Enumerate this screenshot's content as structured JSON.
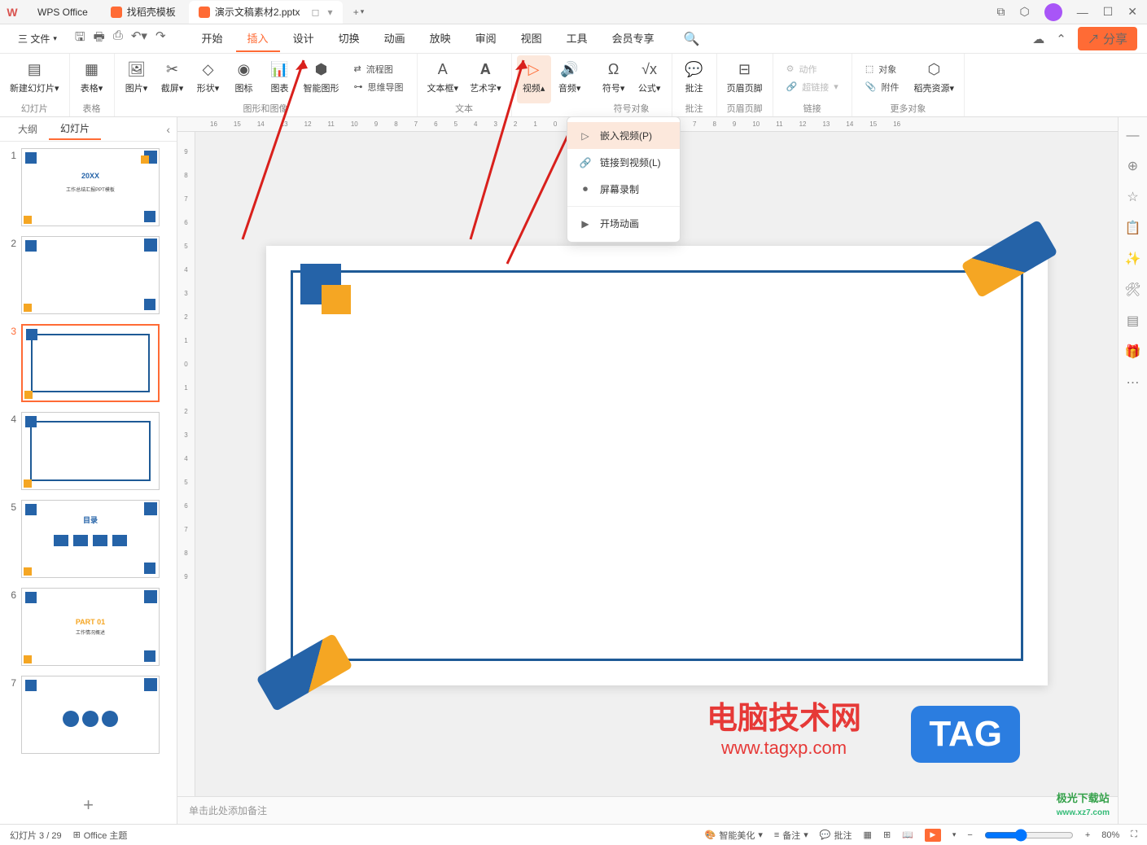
{
  "titlebar": {
    "app_name": "WPS Office",
    "tab_find": "找稻壳模板",
    "tab_doc": "演示文稿素材2.pptx",
    "add": "+"
  },
  "menubar": {
    "file": "三 文件",
    "tabs": [
      "开始",
      "插入",
      "设计",
      "切换",
      "动画",
      "放映",
      "审阅",
      "视图",
      "工具",
      "会员专享"
    ],
    "share": "↗ 分享"
  },
  "ribbon": {
    "new_slide": "新建幻灯片",
    "table": "表格",
    "image": "图片",
    "screenshot": "截屏",
    "shape": "形状",
    "icon": "图标",
    "chart": "图表",
    "smart_art": "智能图形",
    "flowchart": "流程图",
    "mindmap": "思维导图",
    "textbox": "文本框",
    "wordart": "艺术字",
    "video": "视频",
    "audio": "音频",
    "symbol": "符号",
    "formula": "公式",
    "comment": "批注",
    "header_footer": "页眉页脚",
    "action": "动作",
    "hyperlink": "超链接",
    "object": "对象",
    "attachment": "附件",
    "docer": "稻壳资源",
    "group_slide": "幻灯片",
    "group_table": "表格",
    "group_image": "图形和图像",
    "group_text": "文本",
    "group_symbol": "符号对象",
    "group_comment": "批注",
    "group_hf": "页眉页脚",
    "group_link": "链接",
    "group_more": "更多对象"
  },
  "dropdown": {
    "embed_video": "嵌入视频(P)",
    "link_video": "链接到视频(L)",
    "screen_record": "屏幕录制",
    "opening_anim": "开场动画"
  },
  "panel": {
    "outline": "大纲",
    "slides": "幻灯片",
    "collapse": "‹"
  },
  "thumbs": {
    "t1_title": "20XX",
    "t1_sub": "工作总结汇报PPT模板",
    "t5_label": "目录",
    "t6_part": "PART 01",
    "t6_title": "工作情况概述"
  },
  "notes": {
    "placeholder": "单击此处添加备注"
  },
  "statusbar": {
    "slide_info": "幻灯片 3 / 29",
    "theme": "Office 主题",
    "beautify": "智能美化",
    "notes": "备注",
    "comment": "批注",
    "zoom": "80%"
  },
  "watermark": {
    "line1": "电脑技术网",
    "line2": "www.tagxp.com",
    "tag": "TAG",
    "jg": "极光下载站",
    "jg_url": "www.xz7.com"
  }
}
